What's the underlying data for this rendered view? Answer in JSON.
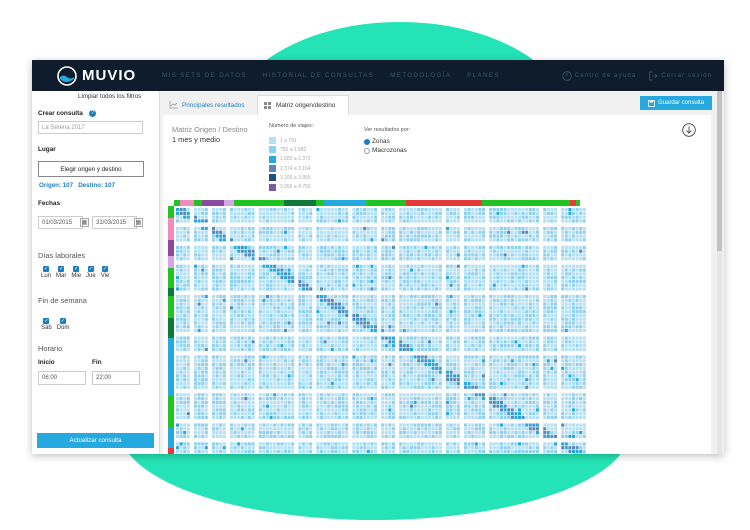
{
  "brand": {
    "name": "MUVIO"
  },
  "nav": [
    "MIS SETS DE DATOS",
    "HISTORIAL DE CONSULTAS",
    "METODOLOGÍA",
    "PLANES"
  ],
  "topright": {
    "help": "Centro de ayuda",
    "logout": "Cerrar sesión"
  },
  "sidebar": {
    "clear_filters": "Limpiar todos los filtros",
    "create_label": "Crear consulta",
    "query_name_placeholder": "La Serena 2017",
    "place_label": "Lugar",
    "choose_btn": "Elegir origen y destino",
    "origin_dest": "Origen: 107   Destino: 107",
    "dates_label": "Fechas",
    "date_from": "01/03/2015",
    "date_to": "31/03/2015",
    "weekdays_label": "Días laborales",
    "weekdays": [
      "Lun",
      "Mar",
      "Mie",
      "Jue",
      "Vie"
    ],
    "weekend_label": "Fin de semana",
    "weekend": [
      "Sáb",
      "Dom"
    ],
    "schedule_label": "Horario",
    "start_label": "Inicio",
    "end_label": "Fin",
    "start_value": "06:00",
    "end_value": "22:00",
    "update_btn": "Actualizar consulta"
  },
  "tabs": [
    "Principales resultados",
    "Matriz origen/destino"
  ],
  "save_btn": "Guardar consulta",
  "panel": {
    "title": "Matriz Origen / Destino",
    "subtitle": "1 mes y medio",
    "legend_title": "Número de viajes:",
    "legend": [
      {
        "label": "1 a 791",
        "color": "#b3e0f5"
      },
      {
        "label": "792 a 1.582",
        "color": "#8fd0ef"
      },
      {
        "label": "1.583 a 2.373",
        "color": "#25a9df"
      },
      {
        "label": "2.374 a 3.164",
        "color": "#5b88b8"
      },
      {
        "label": "3.165 a 3.955",
        "color": "#1f4f87"
      },
      {
        "label": "3.956 a 4.750",
        "color": "#7a5aa0"
      }
    ],
    "view_title": "Ver resultados por:",
    "view_options": [
      "Zonas",
      "Macrozonas"
    ],
    "view_selected": "Zonas"
  },
  "colors": {
    "accent": "#25a9df",
    "topbar": "#0f1c2c",
    "blob": "#24e3b6"
  }
}
